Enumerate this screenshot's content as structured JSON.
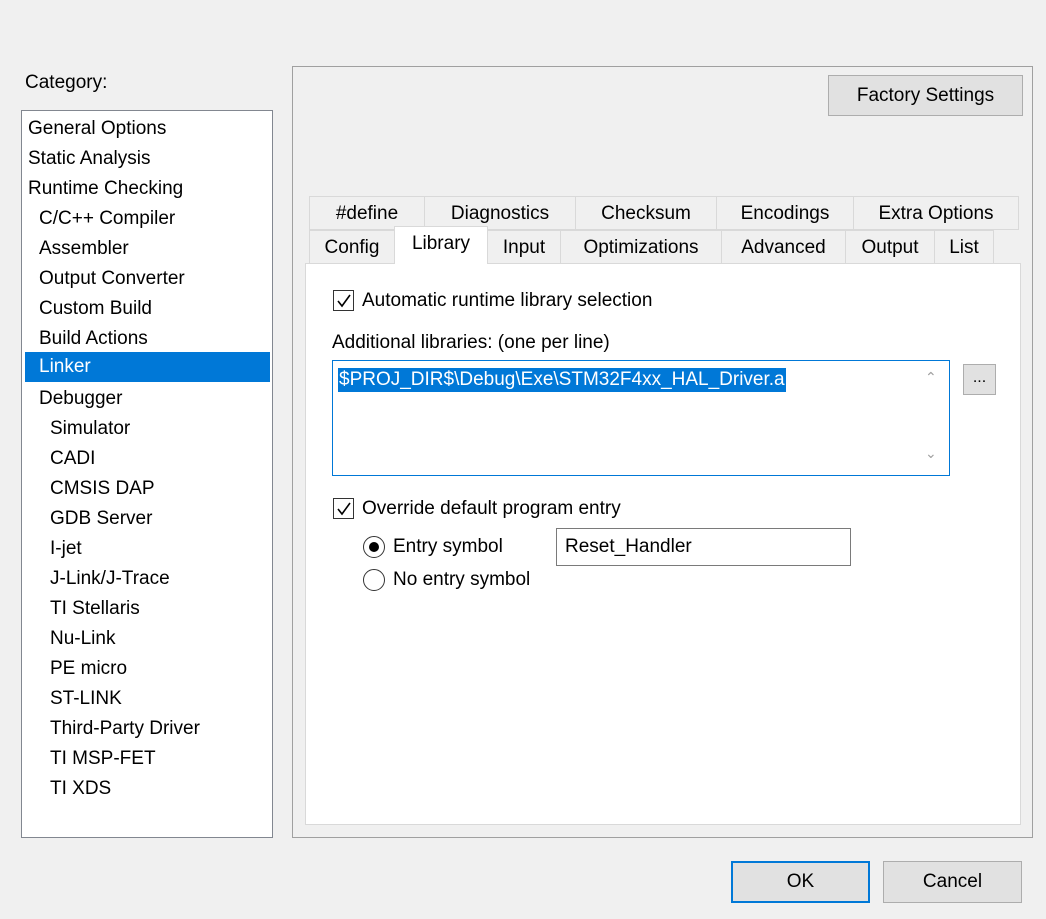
{
  "category": {
    "label": "Category:",
    "items": [
      "General Options",
      "Static Analysis",
      "Runtime Checking",
      "C/C++ Compiler",
      "Assembler",
      "Output Converter",
      "Custom Build",
      "Build Actions",
      "Linker",
      "Debugger",
      "Simulator",
      "CADI",
      "CMSIS DAP",
      "GDB Server",
      "I-jet",
      "J-Link/J-Trace",
      "TI Stellaris",
      "Nu-Link",
      "PE micro",
      "ST-LINK",
      "Third-Party Driver",
      "TI MSP-FET",
      "TI XDS"
    ],
    "selected": "Linker"
  },
  "factory_settings_label": "Factory Settings",
  "tabs": {
    "row1": [
      "#define",
      "Diagnostics",
      "Checksum",
      "Encodings",
      "Extra Options"
    ],
    "row2": [
      "Config",
      "Library",
      "Input",
      "Optimizations",
      "Advanced",
      "Output",
      "List"
    ],
    "active": "Library"
  },
  "library": {
    "auto_runtime_label": "Automatic runtime library selection",
    "auto_runtime_checked": true,
    "additional_libs_label": "Additional libraries: (one per line)",
    "additional_libs_value": "$PROJ_DIR$\\Debug\\Exe\\STM32F4xx_HAL_Driver.a",
    "browse_label": "...",
    "override_entry_label": "Override default program entry",
    "override_entry_checked": true,
    "entry_symbol_label": "Entry symbol",
    "entry_symbol_value": "Reset_Handler",
    "no_entry_symbol_label": "No entry symbol",
    "entry_mode": "entry_symbol"
  },
  "footer": {
    "ok_label": "OK",
    "cancel_label": "Cancel"
  },
  "colors": {
    "selection": "#0078d7",
    "background": "#f0f0f0"
  }
}
